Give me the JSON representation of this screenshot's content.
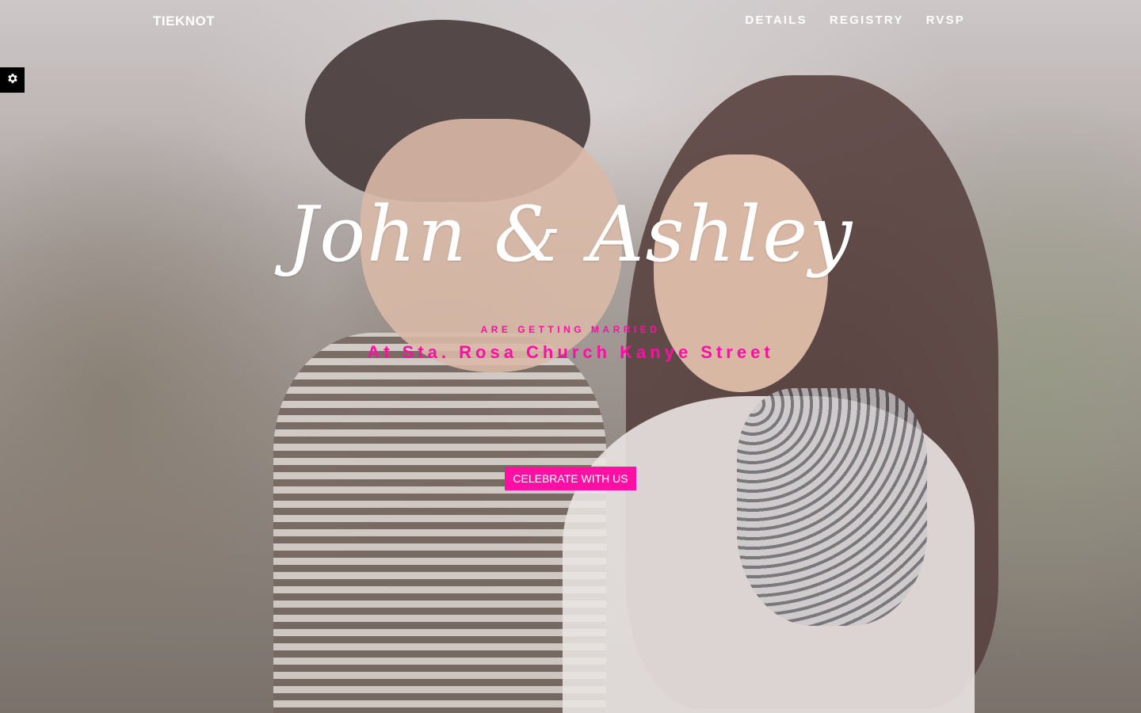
{
  "nav": {
    "brand": "TIEKNOT",
    "links": [
      "DETAILS",
      "REGISTRY",
      "RVSP"
    ]
  },
  "hero": {
    "headline": "John & Ashley",
    "subtitle": "ARE GETTING MARRIED",
    "venue": "At Sta. Rosa Church Kanye Street",
    "cta_label": "CELEBRATE WITH US"
  },
  "icons": {
    "settings": "gear-icon"
  },
  "colors": {
    "accent": "#ff0fa3",
    "nav_text": "#ffffff",
    "settings_bg": "#000000"
  }
}
